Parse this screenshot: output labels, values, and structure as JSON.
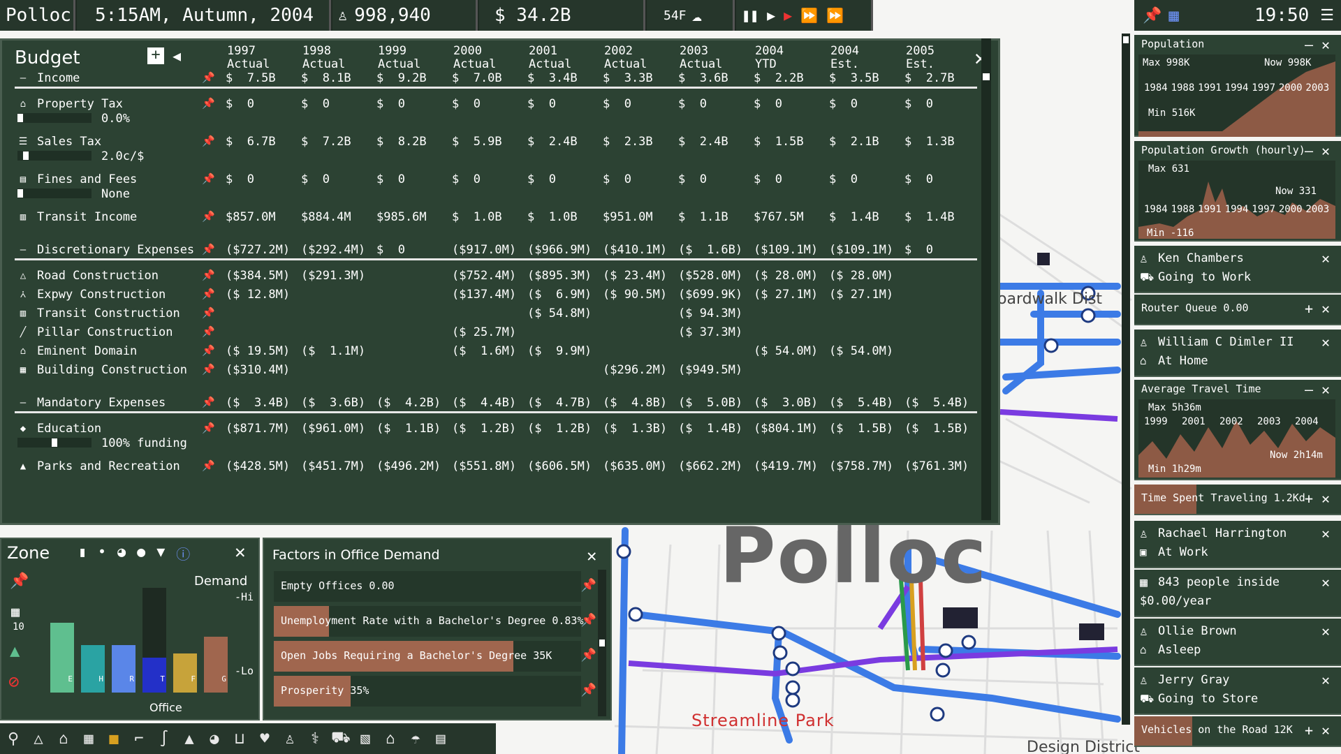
{
  "topbar": {
    "city": "Polloc",
    "datetime": "5:15AM, Autumn, 2004",
    "population": "998,940",
    "money": "$ 34.2B",
    "temp": "54F",
    "clock": "19:50"
  },
  "map": {
    "city_label": "Polloc",
    "park_label": "Streamline Park",
    "district1": "oardwalk Dist",
    "district2": "Design District"
  },
  "budget": {
    "title": "Budget",
    "years": [
      {
        "y": "1997",
        "s": "Actual"
      },
      {
        "y": "1998",
        "s": "Actual"
      },
      {
        "y": "1999",
        "s": "Actual"
      },
      {
        "y": "2000",
        "s": "Actual"
      },
      {
        "y": "2001",
        "s": "Actual"
      },
      {
        "y": "2002",
        "s": "Actual"
      },
      {
        "y": "2003",
        "s": "Actual"
      },
      {
        "y": "2004",
        "s": "YTD"
      },
      {
        "y": "2004",
        "s": "Est."
      },
      {
        "y": "2005",
        "s": "Est."
      }
    ],
    "rows": [
      {
        "label": "Income",
        "section": true,
        "vals": [
          "$  7.5B",
          "$  8.1B",
          "$  9.2B",
          "$  7.0B",
          "$  3.4B",
          "$  3.3B",
          "$  3.6B",
          "$  2.2B",
          "$  3.5B",
          "$  2.7B"
        ]
      },
      {
        "label": "Property Tax",
        "icon": "house-icon",
        "vals": [
          "$  0",
          "$  0",
          "$  0",
          "$  0",
          "$  0",
          "$  0",
          "$  0",
          "$  0",
          "$  0",
          "$  0"
        ],
        "sub": "0.0%",
        "knob": 0.0
      },
      {
        "label": "Sales Tax",
        "icon": "cart-icon",
        "vals": [
          "$  6.7B",
          "$  7.2B",
          "$  8.2B",
          "$  5.9B",
          "$  2.4B",
          "$  2.3B",
          "$  2.4B",
          "$  1.5B",
          "$  2.1B",
          "$  1.3B"
        ],
        "sub": "2.0c/$",
        "knob": 0.08
      },
      {
        "label": "Fines and Fees",
        "icon": "document-icon",
        "vals": [
          "$  0",
          "$  0",
          "$  0",
          "$  0",
          "$  0",
          "$  0",
          "$  0",
          "$  0",
          "$  0",
          "$  0"
        ],
        "sub": "None",
        "knob": 0.0
      },
      {
        "label": "Transit Income",
        "icon": "bus-icon",
        "vals": [
          "$857.0M",
          "$884.4M",
          "$985.6M",
          "$  1.0B",
          "$  1.0B",
          "$951.0M",
          "$  1.1B",
          "$767.5M",
          "$  1.4B",
          "$  1.4B"
        ]
      },
      {
        "label": "Discretionary Expenses",
        "section": true,
        "vals": [
          "($727.2M)",
          "($292.4M)",
          "$  0",
          "($917.0M)",
          "($966.9M)",
          "($410.1M)",
          "($  1.6B)",
          "($109.1M)",
          "($109.1M)",
          "$  0"
        ]
      },
      {
        "label": "Road Construction",
        "icon": "road-icon",
        "vals": [
          "($384.5M)",
          "($291.3M)",
          "",
          "($752.4M)",
          "($895.3M)",
          "($ 23.4M)",
          "($528.0M)",
          "($ 28.0M)",
          "($ 28.0M)",
          ""
        ]
      },
      {
        "label": "Expwy Construction",
        "icon": "highway-icon",
        "vals": [
          "($ 12.8M)",
          "",
          "",
          "($137.4M)",
          "($  6.9M)",
          "($ 90.5M)",
          "($699.9K)",
          "($ 27.1M)",
          "($ 27.1M)",
          ""
        ]
      },
      {
        "label": "Transit Construction",
        "icon": "bus-icon",
        "vals": [
          "",
          "",
          "",
          "",
          "($ 54.8M)",
          "",
          "($ 94.3M)",
          "",
          "",
          ""
        ]
      },
      {
        "label": "Pillar Construction",
        "icon": "pillar-icon",
        "vals": [
          "",
          "",
          "",
          "($ 25.7M)",
          "",
          "",
          "($ 37.3M)",
          "",
          "",
          ""
        ]
      },
      {
        "label": "Eminent Domain",
        "icon": "house-icon",
        "vals": [
          "($ 19.5M)",
          "($  1.1M)",
          "",
          "($  1.6M)",
          "($  9.9M)",
          "",
          "",
          "($ 54.0M)",
          "($ 54.0M)",
          ""
        ]
      },
      {
        "label": "Building Construction",
        "icon": "building-icon",
        "vals": [
          "($310.4M)",
          "",
          "",
          "",
          "",
          "($296.2M)",
          "($949.5M)",
          "",
          "",
          ""
        ]
      },
      {
        "label": "Mandatory Expenses",
        "section": true,
        "vals": [
          "($  3.4B)",
          "($  3.6B)",
          "($  4.2B)",
          "($  4.4B)",
          "($  4.7B)",
          "($  4.8B)",
          "($  5.0B)",
          "($  3.0B)",
          "($  5.4B)",
          "($  5.4B)"
        ]
      },
      {
        "label": "Education",
        "icon": "mortarboard-icon",
        "vals": [
          "($871.7M)",
          "($961.0M)",
          "($  1.1B)",
          "($  1.2B)",
          "($  1.2B)",
          "($  1.3B)",
          "($  1.4B)",
          "($804.1M)",
          "($  1.5B)",
          "($  1.5B)"
        ],
        "sub": "100% funding",
        "knob": 0.5
      },
      {
        "label": "Parks and Recreation",
        "icon": "tree-icon",
        "vals": [
          "($428.5M)",
          "($451.7M)",
          "($496.2M)",
          "($551.8M)",
          "($606.5M)",
          "($635.0M)",
          "($662.2M)",
          "($419.7M)",
          "($758.7M)",
          "($761.3M)"
        ]
      }
    ]
  },
  "right": {
    "population": {
      "title": "Population",
      "max": "Max  998K",
      "now": "Now  998K",
      "min": "Min  516K",
      "years": [
        "1984",
        "1988",
        "1991",
        "1994",
        "1997",
        "2000",
        "2003"
      ]
    },
    "growth": {
      "title": "Population Growth (hourly)",
      "max": "Max  631",
      "now": "Now  331",
      "min": "Min -116",
      "years": [
        "1984",
        "1988",
        "1991",
        "1994",
        "1997",
        "2000",
        "2003"
      ]
    },
    "person1": {
      "name": "Ken Chambers",
      "status": "Going to Work"
    },
    "router": "Router Queue 0.00",
    "person2": {
      "name": "William C Dimler II",
      "status": "At Home"
    },
    "travel": {
      "title": "Average Travel Time",
      "max": "Max 5h36m",
      "now": "Now 2h14m",
      "min": "Min 1h29m",
      "years": [
        "1999",
        "2001",
        "2002",
        "2003",
        "2004"
      ]
    },
    "timespent": "Time Spent Traveling 1.2Kd",
    "person3": {
      "name": "Rachael Harrington",
      "status": "At Work"
    },
    "building": {
      "name": "843 people inside",
      "status": "$0.00/year"
    },
    "person4": {
      "name": "Ollie Brown",
      "status": "Asleep"
    },
    "person5": {
      "name": "Jerry Gray",
      "status": "Going to Store"
    },
    "vehicles": "Vehicles on the Road 12K"
  },
  "zone": {
    "title": "Zone",
    "demand": "Demand",
    "hi": "-Hi",
    "lo": "-Lo",
    "office": "Office",
    "lv10": "10",
    "bars": [
      {
        "letter": "E",
        "color": "#5fbf8f",
        "level": 0.62
      },
      {
        "letter": "H",
        "color": "#2aa3a3",
        "level": 0.35
      },
      {
        "letter": "R",
        "color": "#5a86e8",
        "level": 0.35
      },
      {
        "letter": "T",
        "color": "#2330c8",
        "level": 0.2
      },
      {
        "letter": "F",
        "color": "#c7a33a",
        "level": 0.25
      },
      {
        "letter": "G",
        "color": "#a0664e",
        "level": 0.45
      }
    ]
  },
  "factors": {
    "title": "Factors in Office Demand",
    "items": [
      {
        "label": "Empty Offices 0.00",
        "fill": 0.0
      },
      {
        "label": "Unemployment Rate with a Bachelor's Degree 0.83%",
        "fill": 0.18
      },
      {
        "label": "Open Jobs Requiring a Bachelor's Degree 35K",
        "fill": 0.78
      },
      {
        "label": "Prosperity 35%",
        "fill": 0.25
      }
    ]
  }
}
